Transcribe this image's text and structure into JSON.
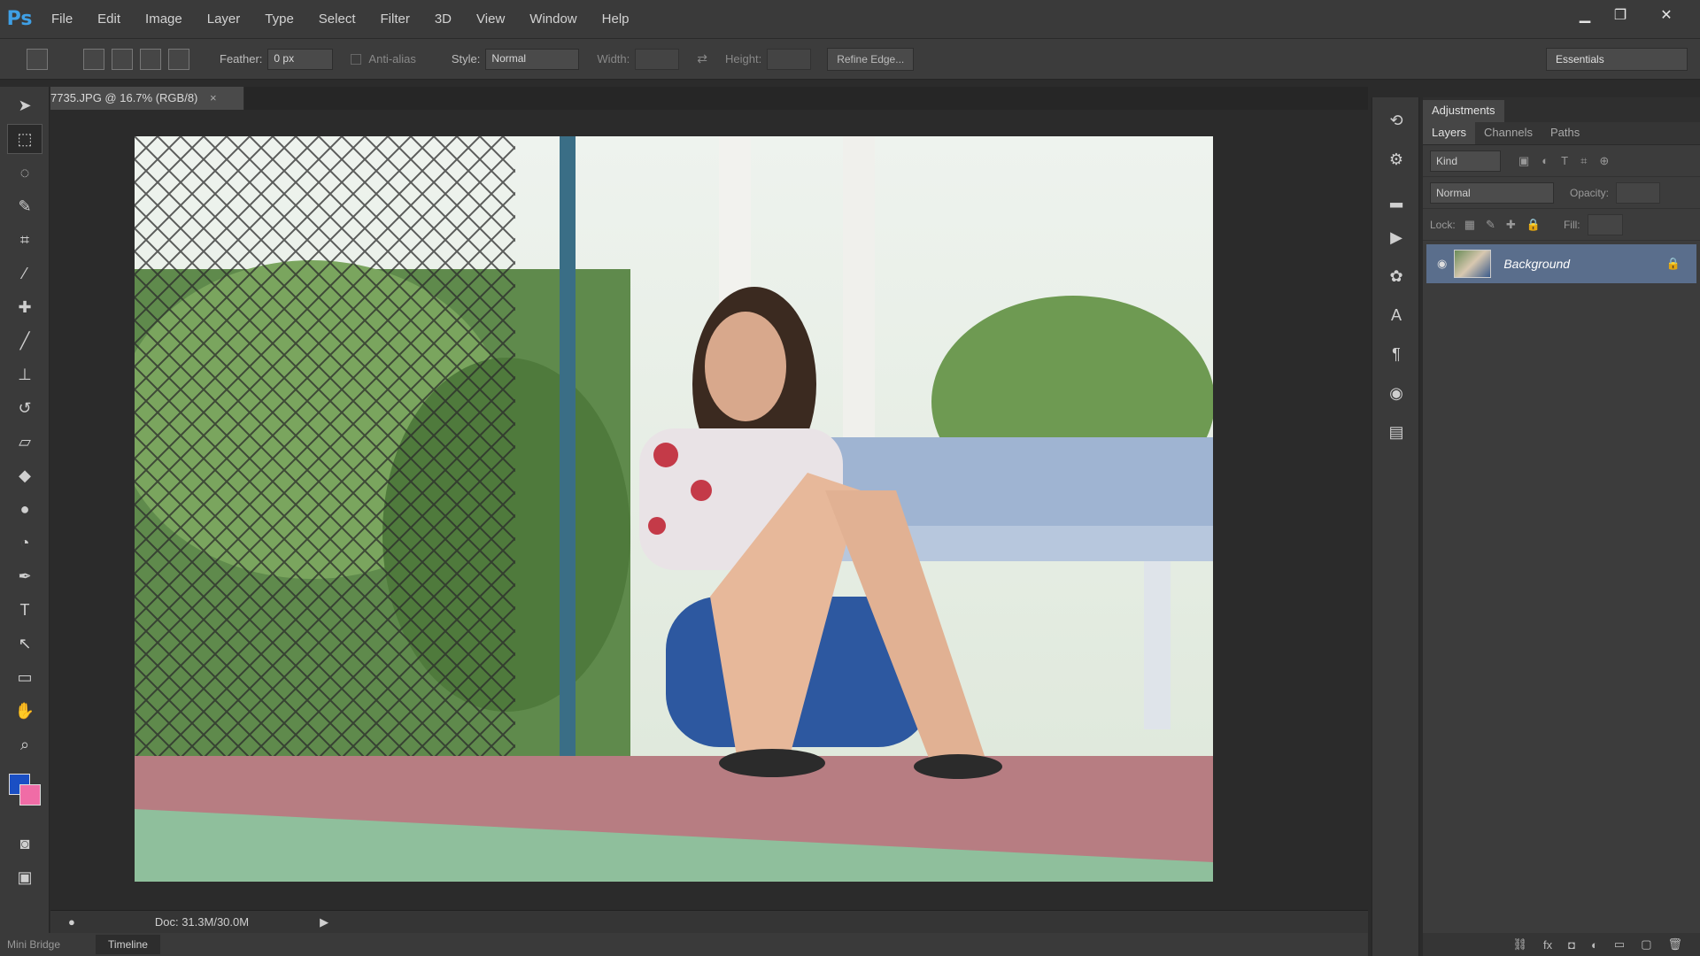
{
  "app": {
    "logo": "Ps"
  },
  "menu": [
    "File",
    "Edit",
    "Image",
    "Layer",
    "Type",
    "Select",
    "Filter",
    "3D",
    "View",
    "Window",
    "Help"
  ],
  "window_controls": {
    "minimize": "▁",
    "restore": "❐",
    "close": "✕"
  },
  "options": {
    "feather_label": "Feather:",
    "feather_value": "0 px",
    "antialias_label": "Anti-alias",
    "style_label": "Style:",
    "style_value": "Normal",
    "width_label": "Width:",
    "height_label": "Height:",
    "refine_edge": "Refine Edge...",
    "workspace": "Essentials"
  },
  "document": {
    "tab_title": "7735.JPG @ 16.7% (RGB/8)",
    "status": "Doc: 31.3M/30.0M",
    "close_glyph": "×"
  },
  "bottom": {
    "mini_bridge": "Mini Bridge",
    "timeline": "Timeline"
  },
  "panels": {
    "adjustments_tab": "Adjustments",
    "tabs": [
      "Layers",
      "Channels",
      "Paths"
    ],
    "kind": "Kind",
    "blend_mode": "Normal",
    "opacity_label": "Opacity:",
    "lock_label": "Lock:",
    "fill_label": "Fill:",
    "layer_name": "Background"
  },
  "colors": {
    "foreground": "#1a4fc4",
    "background": "#f06ca6",
    "layer_selected": "#5a6e8c"
  },
  "icons": [
    "move-icon",
    "marquee-icon",
    "lasso-icon",
    "quick-select-icon",
    "crop-icon",
    "eyedropper-icon",
    "healing-icon",
    "brush-icon",
    "stamp-icon",
    "history-brush-icon",
    "eraser-icon",
    "paint-bucket-icon",
    "blur-icon",
    "dodge-icon",
    "pen-icon",
    "type-icon",
    "path-select-icon",
    "rectangle-icon",
    "hand-icon",
    "zoom-icon"
  ]
}
